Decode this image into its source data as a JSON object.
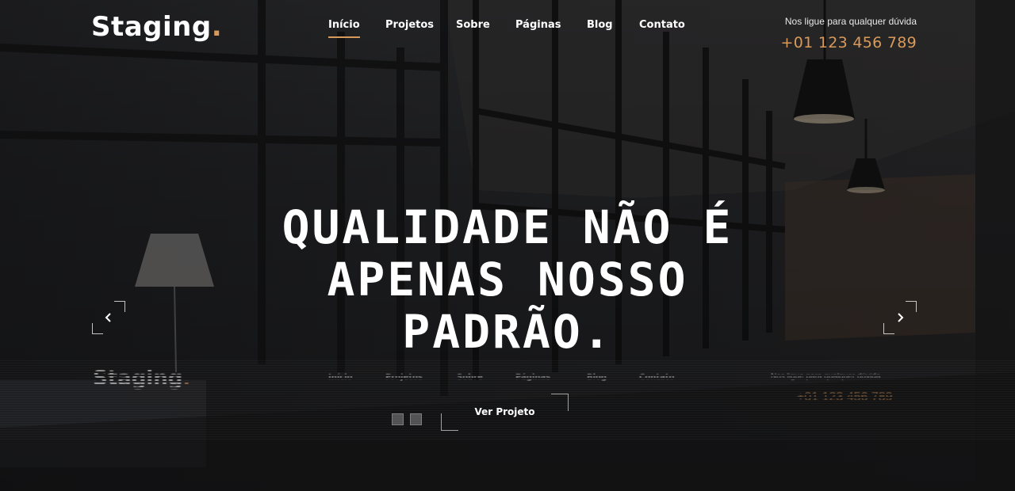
{
  "header": {
    "logo_text": "Staging",
    "logo_dot": ".",
    "contact_label": "Nos ligue para qualquer dúvida",
    "contact_phone": "+01 123 456 789"
  },
  "nav": {
    "items": [
      {
        "label": "Início",
        "active": true
      },
      {
        "label": "Projetos",
        "active": false
      },
      {
        "label": "Sobre",
        "active": false
      },
      {
        "label": "Páginas",
        "active": false
      },
      {
        "label": "Blog",
        "active": false
      },
      {
        "label": "Contato",
        "active": false
      }
    ]
  },
  "hero": {
    "title_lines": [
      "QUALIDADE NÃO É",
      "APENAS NOSSO",
      "PADRÃO."
    ],
    "cta_label": "Ver Projeto",
    "prev_icon": "chevron-left-icon",
    "next_icon": "chevron-right-icon",
    "slide_count": 2,
    "active_slide": 1
  },
  "colors": {
    "accent": "#d89a5a",
    "text": "#ffffff"
  }
}
